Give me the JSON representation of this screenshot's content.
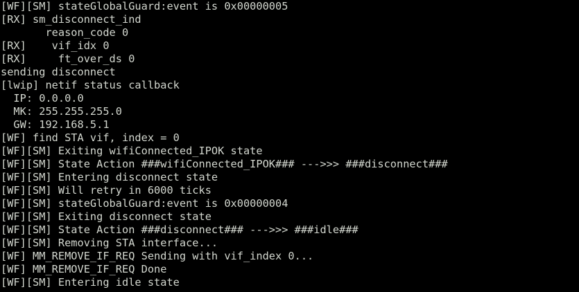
{
  "terminal": {
    "background": "#000000",
    "foreground": "#d3d7cf",
    "lines": [
      "[WF][SM] stateGlobalGuard:event is 0x00000005",
      "[RX] sm_disconnect_ind",
      "       reason_code 0",
      "[RX]    vif_idx 0",
      "[RX]     ft_over_ds 0",
      "sending disconnect",
      "[lwip] netif status callback",
      "  IP: 0.0.0.0",
      "  MK: 255.255.255.0",
      "  GW: 192.168.5.1",
      "[WF] find STA vif, index = 0",
      "[WF][SM] Exiting wifiConnected_IPOK state",
      "[WF][SM] State Action ###wifiConnected_IPOK### --->>> ###disconnect###",
      "[WF][SM] Entering disconnect state",
      "[WF][SM] Will retry in 6000 ticks",
      "[WF][SM] stateGlobalGuard:event is 0x00000004",
      "[WF][SM] Exiting disconnect state",
      "[WF][SM] State Action ###disconnect### --->>> ###idle###",
      "[WF][SM] Removing STA interface...",
      "[WF] MM_REMOVE_IF_REQ Sending with vif_index 0...",
      "[WF] MM_REMOVE_IF_REQ Done",
      "[WF][SM] Entering idle state"
    ]
  }
}
